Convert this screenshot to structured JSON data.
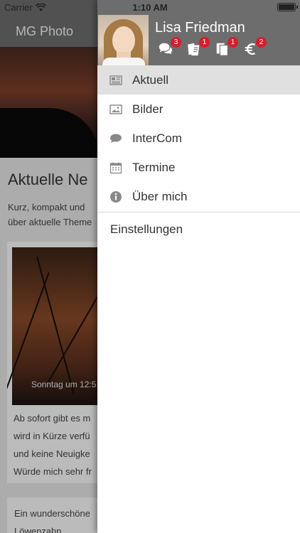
{
  "status_bar": {
    "carrier": "Carrier",
    "time": "1:10 AM"
  },
  "background": {
    "app_title": "MG Photo",
    "heading": "Aktuelle Ne",
    "intro_lines": [
      "Kurz, kompakt und",
      "über aktuelle Theme"
    ],
    "card1": {
      "photo_caption": "Sonntag um 12:5",
      "text_lines": [
        "Ab sofort gibt es m",
        "wird in Kürze verfü",
        "und keine Neuigke",
        "Würde mich sehr fr"
      ]
    },
    "card2": {
      "text_lines": [
        "Ein wunderschöne",
        "Löwenzahn..."
      ]
    }
  },
  "drawer": {
    "user_name": "Lisa Friedman",
    "header_icons": [
      {
        "icon": "chat-bubbles-icon",
        "badge": "3"
      },
      {
        "icon": "notes-icon",
        "badge": "1"
      },
      {
        "icon": "documents-icon",
        "badge": "1"
      },
      {
        "icon": "euro-icon",
        "badge": "2"
      }
    ],
    "menu": [
      {
        "label": "Aktuell",
        "icon": "newspaper-icon",
        "active": true
      },
      {
        "label": "Bilder",
        "icon": "image-icon",
        "active": false
      },
      {
        "label": "InterCom",
        "icon": "chat-bubble-icon",
        "active": false
      },
      {
        "label": "Termine",
        "icon": "calendar-icon",
        "active": false
      },
      {
        "label": "Über mich",
        "icon": "info-icon",
        "active": false
      }
    ],
    "settings_label": "Einstellungen"
  },
  "colors": {
    "header_bg": "#6d6d6d",
    "badge": "#d0202a",
    "active_row": "#e0e0e0"
  }
}
